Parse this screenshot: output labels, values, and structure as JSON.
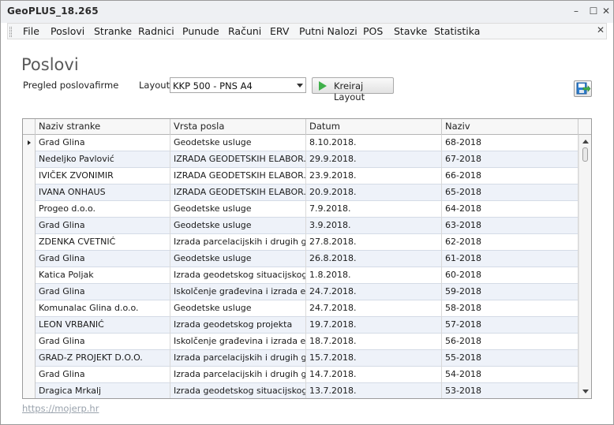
{
  "window": {
    "title": "GeoPLUS_18.265",
    "min_label": "–",
    "max_label": "☐",
    "close_label": "✕"
  },
  "menu": {
    "items": [
      "File",
      "Poslovi",
      "Stranke",
      "Radnici",
      "Punude",
      "Računi",
      "ERV",
      "Putni Nalozi",
      "POS",
      "Stavke",
      "Statistika"
    ],
    "close_label": "✕"
  },
  "page": {
    "title": "Poslovi",
    "subtitle": "Pregled poslovafirme",
    "layout_label": "Layout",
    "layout_value": "KKP 500 - PNS A4",
    "create_button": "Kreiraj Layout",
    "export_icon": "save-export-icon"
  },
  "table": {
    "columns": [
      "Naziv stranke",
      "Vrsta posla",
      "Datum",
      "Naziv"
    ],
    "rows": [
      [
        "Grad Glina",
        "Geodetske usluge",
        "8.10.2018.",
        "68-2018"
      ],
      [
        "Nedeljko Pavlović",
        "IZRADA GEODETSKIH ELABOR...",
        "29.9.2018.",
        "67-2018"
      ],
      [
        "IVIČEK ZVONIMIR",
        "IZRADA GEODETSKIH ELABOR...",
        "23.9.2018.",
        "66-2018"
      ],
      [
        "IVANA ONHAUS",
        "IZRADA GEODETSKIH ELABOR...",
        "20.9.2018.",
        "65-2018"
      ],
      [
        "Progeo d.o.o.",
        "Geodetske usluge",
        "7.9.2018.",
        "64-2018"
      ],
      [
        "Grad Glina",
        "Geodetske usluge",
        "3.9.2018.",
        "63-2018"
      ],
      [
        "ZDENKA CVETNIĆ",
        "Izrada parcelacijskih i drugih ge...",
        "27.8.2018.",
        "62-2018"
      ],
      [
        "Grad Glina",
        "Geodetske usluge",
        "26.8.2018.",
        "61-2018"
      ],
      [
        "Katica Poljak",
        "Izrada geodetskog situacijskog ...",
        "1.8.2018.",
        "60-2018"
      ],
      [
        "Grad Glina",
        "Iskolčenje građevina i izrada el...",
        "24.7.2018.",
        "59-2018"
      ],
      [
        "Komunalac Glina d.o.o.",
        "Geodetske usluge",
        "24.7.2018.",
        "58-2018"
      ],
      [
        "LEON VRBANIĆ",
        "Izrada geodetskog projekta",
        "19.7.2018.",
        "57-2018"
      ],
      [
        "Grad Glina",
        "Iskolčenje građevina i izrada el...",
        "18.7.2018.",
        "56-2018"
      ],
      [
        "GRAD-Z PROJEKT D.O.O.",
        "Izrada parcelacijskih i drugih ge...",
        "15.7.2018.",
        "55-2018"
      ],
      [
        "Grad Glina",
        "Izrada parcelacijskih i drugih ge...",
        "14.7.2018.",
        "54-2018"
      ],
      [
        "Dragica Mrkalj",
        "Izrada geodetskog situacijskog ...",
        "13.7.2018.",
        "53-2018"
      ]
    ]
  },
  "footer": {
    "link": "https://mojerp.hr"
  }
}
